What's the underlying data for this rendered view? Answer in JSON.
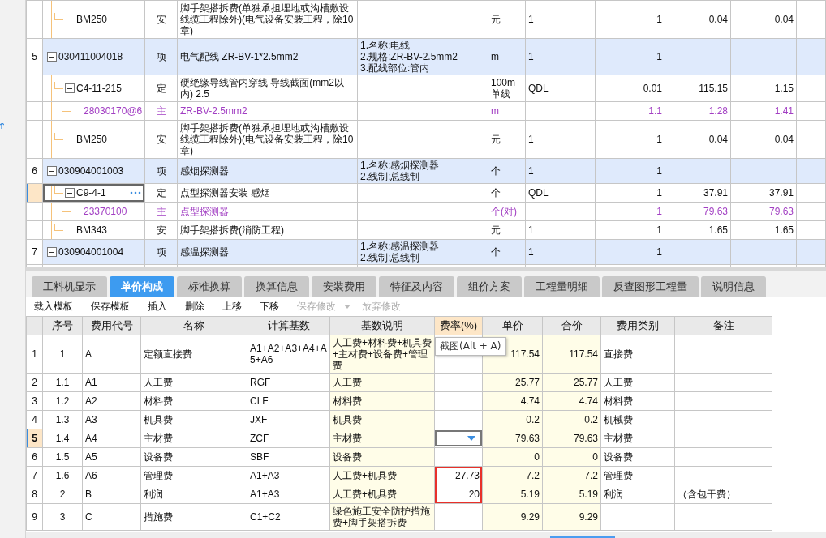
{
  "bill_rows": [
    {
      "kind": "entry",
      "code": "BM250",
      "type": "安",
      "name": "脚手架搭拆费(单独承担埋地或沟槽敷设线缆工程除外)(电气设备安装工程，除10章)",
      "unit": "元",
      "expr": "1",
      "qty": "1",
      "price": "0.04",
      "total": "0.04",
      "selected": false
    },
    {
      "kind": "item",
      "index": "5",
      "expanded": true,
      "code": "030411004018",
      "type": "项",
      "name": "电气配线 ZR-BV-1*2.5mm2",
      "features": [
        "1.名称:电线",
        "2.规格:ZR-BV-2.5mm2",
        "3.配线部位:管内"
      ],
      "unit": "m",
      "expr": "1",
      "qty": "1",
      "selected": false,
      "children": [
        {
          "kind": "entry",
          "expanded": true,
          "code": "C4-11-215",
          "type": "定",
          "name": "硬绝缘导线管内穿线 导线截面(mm2以内) 2.5",
          "unit": "100m单线",
          "expr": "QDL",
          "qty": "0.01",
          "price": "115.15",
          "total": "1.15",
          "selected": false,
          "children": [
            {
              "kind": "material",
              "code": "28030170@6",
              "type": "主",
              "name": "ZR-BV-2.5mm2",
              "unit": "m",
              "qty": "1.1",
              "price": "1.28",
              "total": "1.41",
              "selected": false
            }
          ]
        },
        {
          "kind": "entry",
          "code": "BM250",
          "type": "安",
          "name": "脚手架搭拆费(单独承担埋地或沟槽敷设线缆工程除外)(电气设备安装工程，除10章)",
          "unit": "元",
          "expr": "1",
          "qty": "1",
          "price": "0.04",
          "total": "0.04",
          "selected": false
        }
      ]
    },
    {
      "kind": "item",
      "index": "6",
      "expanded": true,
      "code": "030904001003",
      "type": "项",
      "name": "感烟探测器",
      "features": [
        "1.名称:感烟探测器",
        "2.线制:总线制"
      ],
      "unit": "个",
      "expr": "1",
      "qty": "1",
      "selected": false,
      "children": [
        {
          "kind": "entry",
          "expanded": true,
          "code": "C9-4-1",
          "type": "定",
          "name": "点型探测器安装 感烟",
          "unit": "个",
          "expr": "QDL",
          "qty": "1",
          "price": "37.91",
          "total": "37.91",
          "selected": true,
          "children": [
            {
              "kind": "material",
              "code": "23370100",
              "type": "主",
              "name": "点型探测器",
              "unit": "个(对)",
              "qty": "1",
              "price": "79.63",
              "total": "79.63",
              "selected": false
            }
          ]
        },
        {
          "kind": "entry",
          "code": "BM343",
          "type": "安",
          "name": "脚手架搭拆费(消防工程)",
          "unit": "元",
          "expr": "1",
          "qty": "1",
          "price": "1.65",
          "total": "1.65",
          "selected": false
        }
      ]
    },
    {
      "kind": "item",
      "index": "7",
      "expanded": true,
      "code": "030904001004",
      "type": "项",
      "name": "感温探测器",
      "features": [
        "1.名称:感温探测器",
        "2.线制:总线制"
      ],
      "unit": "个",
      "expr": "1",
      "qty": "1",
      "selected": false
    }
  ],
  "tabs": [
    {
      "label": "工料机显示",
      "selected": false
    },
    {
      "label": "单价构成",
      "selected": true
    },
    {
      "label": "标准换算",
      "selected": false
    },
    {
      "label": "换算信息",
      "selected": false
    },
    {
      "label": "安装费用",
      "selected": false
    },
    {
      "label": "特征及内容",
      "selected": false
    },
    {
      "label": "组价方案",
      "selected": false
    },
    {
      "label": "工程量明细",
      "selected": false
    },
    {
      "label": "反查图形工程量",
      "selected": false
    },
    {
      "label": "说明信息",
      "selected": false
    }
  ],
  "toolbar": [
    {
      "label": "载入模板",
      "disabled": false
    },
    {
      "label": "保存模板",
      "disabled": false
    },
    {
      "label": "插入",
      "disabled": false
    },
    {
      "label": "删除",
      "disabled": false
    },
    {
      "label": "上移",
      "disabled": false
    },
    {
      "label": "下移",
      "disabled": false
    },
    {
      "label": "保存修改",
      "disabled": true,
      "dropdown": true
    },
    {
      "label": "放弃修改",
      "disabled": true
    }
  ],
  "price_table": {
    "columns": [
      "序号",
      "费用代号",
      "名称",
      "计算基数",
      "基数说明",
      "费率(%)",
      "单价",
      "合价",
      "费用类别",
      "备注"
    ],
    "rows": [
      {
        "row": "1",
        "seq": "1",
        "code": "A",
        "name": "定额直接费",
        "base": "A1+A2+A3+A4+A5+A6",
        "desc": "人工费+材料费+机具费+主材费+设备费+管理费",
        "price": "117.54",
        "total": "117.54",
        "category": "直接费",
        "selected": false,
        "highlighted": false
      },
      {
        "row": "2",
        "seq": "1.1",
        "code": "A1",
        "name": "人工费",
        "base": "RGF",
        "desc": "人工费",
        "price": "25.77",
        "total": "25.77",
        "category": "人工费",
        "selected": false,
        "highlighted": false
      },
      {
        "row": "3",
        "seq": "1.2",
        "code": "A2",
        "name": "材料费",
        "base": "CLF",
        "desc": "材料费",
        "price": "4.74",
        "total": "4.74",
        "category": "材料费",
        "selected": false,
        "highlighted": false
      },
      {
        "row": "4",
        "seq": "1.3",
        "code": "A3",
        "name": "机具费",
        "base": "JXF",
        "desc": "机具费",
        "price": "0.2",
        "total": "0.2",
        "category": "机械费",
        "selected": false,
        "highlighted": false
      },
      {
        "row": "5",
        "seq": "1.4",
        "code": "A4",
        "name": "主材费",
        "base": "ZCF",
        "desc": "主材费",
        "price": "79.63",
        "total": "79.63",
        "category": "主材费",
        "selected": true,
        "highlighted": false
      },
      {
        "row": "6",
        "seq": "1.5",
        "code": "A5",
        "name": "设备费",
        "base": "SBF",
        "desc": "设备费",
        "price": "0",
        "total": "0",
        "category": "设备费",
        "selected": false,
        "highlighted": false
      },
      {
        "row": "7",
        "seq": "1.6",
        "code": "A6",
        "name": "管理费",
        "base": "A1+A3",
        "desc": "人工费+机具费",
        "rate": "27.73",
        "price": "7.2",
        "total": "7.2",
        "category": "管理费",
        "selected": false,
        "highlighted": true
      },
      {
        "row": "8",
        "seq": "2",
        "code": "B",
        "name": "利润",
        "base": "A1+A3",
        "desc": "人工费+机具费",
        "rate": "20",
        "price": "5.19",
        "total": "5.19",
        "category": "利润",
        "note": "（含包干费）",
        "selected": false,
        "highlighted": true
      },
      {
        "row": "9",
        "seq": "3",
        "code": "C",
        "name": "措施费",
        "base": "C1+C2",
        "desc": "绿色施工安全防护措施费+脚手架搭拆费",
        "price": "9.29",
        "total": "9.29",
        "selected": false,
        "highlighted": false
      }
    ]
  },
  "tooltip": "截图(Alt + A)"
}
